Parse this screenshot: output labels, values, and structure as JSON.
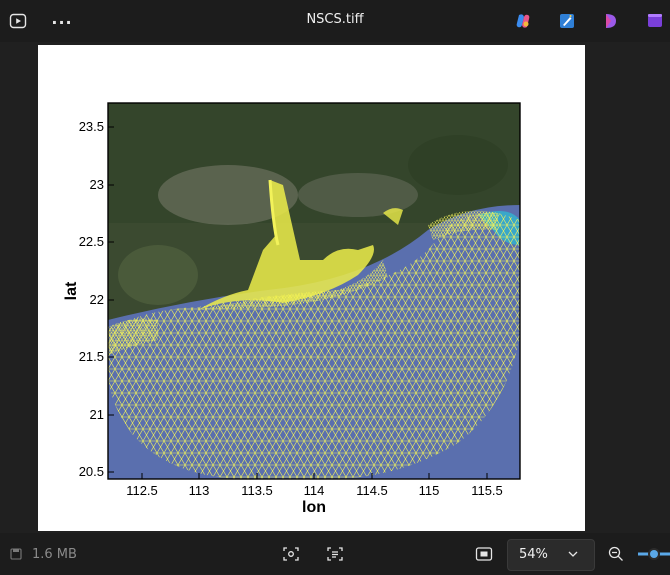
{
  "window": {
    "title": "NSCS.tiff"
  },
  "toolbar": {
    "slideshow_icon": "slideshow-icon",
    "more_label": "...",
    "app_icons": [
      "copilot-icon",
      "edit-icon",
      "designer-icon",
      "clipchamp-icon"
    ]
  },
  "figure": {
    "x_label": "lon",
    "y_label": "lat",
    "x_ticks": [
      "112.5",
      "113",
      "113.5",
      "114",
      "114.5",
      "115",
      "115.5"
    ],
    "y_ticks": [
      "23.5",
      "23",
      "22.5",
      "22",
      "21.5",
      "21",
      "20.5"
    ],
    "mesh_color": "#f2f25a",
    "sea_color": "#5a6fae",
    "land_color": "#3b4a30"
  },
  "status": {
    "file_size": "1.6 MB",
    "zoom": "54%"
  }
}
